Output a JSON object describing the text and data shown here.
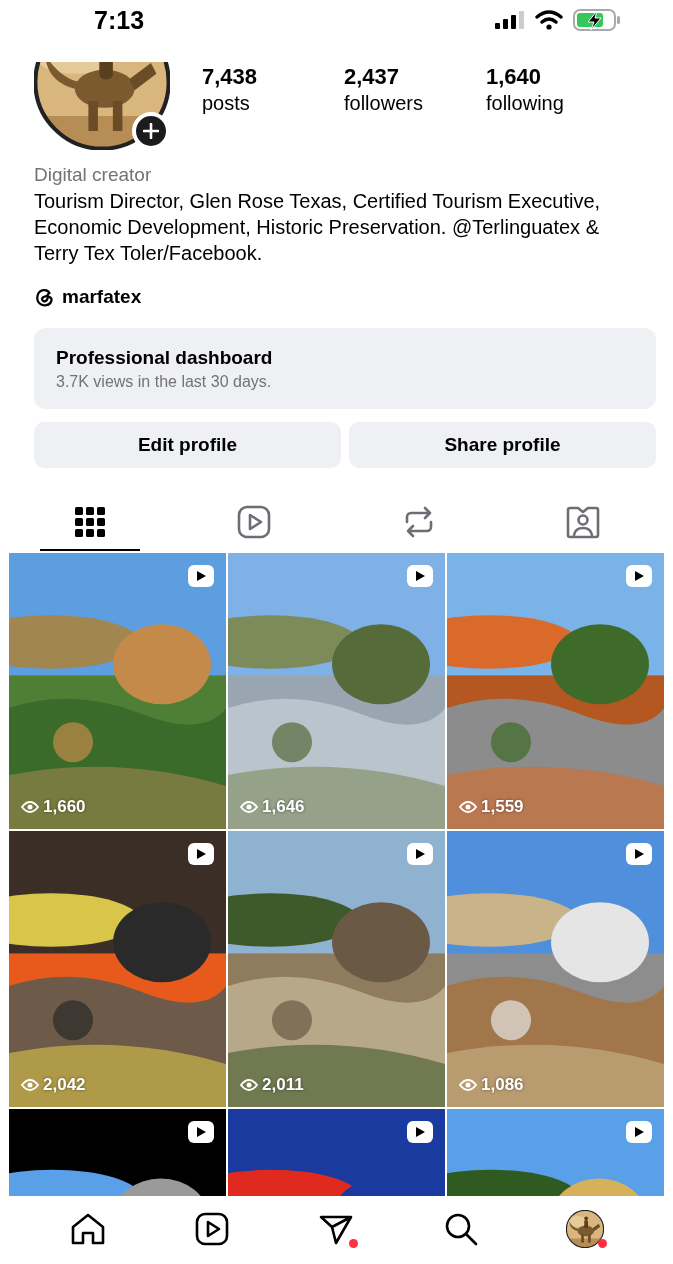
{
  "status_bar": {
    "time": "7:13"
  },
  "profile": {
    "stats": [
      {
        "value": "7,438",
        "label": "posts"
      },
      {
        "value": "2,437",
        "label": "followers"
      },
      {
        "value": "1,640",
        "label": "following"
      }
    ],
    "category": "Digital creator",
    "bio": "Tourism Director, Glen Rose Texas, Certified Tourism Executive, Economic Development, Historic Preservation. @Terlinguatex & Terry Tex Toler/Facebook.",
    "threads_handle": "marfatex"
  },
  "dashboard": {
    "title": "Professional dashboard",
    "subtitle": "3.7K views in the last 30 days."
  },
  "buttons": [
    "Edit profile",
    "Share profile"
  ],
  "tabs": [
    {
      "kind": "grid",
      "selected": true
    },
    {
      "kind": "reels",
      "selected": false
    },
    {
      "kind": "reposts",
      "selected": false
    },
    {
      "kind": "tagged",
      "selected": false
    }
  ],
  "posts": [
    {
      "kind": "picture",
      "views": "1,660"
    },
    {
      "kind": "picture",
      "views": "1,646"
    },
    {
      "kind": "picture",
      "views": "1,559"
    },
    {
      "kind": "picture",
      "views": "2,042"
    },
    {
      "kind": "picture",
      "views": "2,011"
    },
    {
      "kind": "picture",
      "views": "1,086"
    },
    {
      "kind": "picture"
    },
    {
      "kind": "picture"
    },
    {
      "kind": "picture"
    }
  ],
  "bottom_nav": [
    {
      "kind": "home",
      "notification": false
    },
    {
      "kind": "reels",
      "notification": false
    },
    {
      "kind": "messages",
      "notification": true
    },
    {
      "kind": "search",
      "notification": false
    },
    {
      "kind": "profile",
      "notification": true
    }
  ]
}
